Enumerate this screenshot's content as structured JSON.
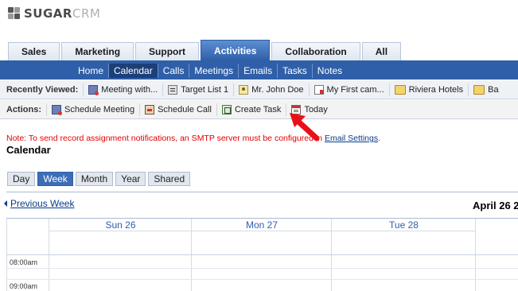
{
  "logo": {
    "text_bold": "SUGAR",
    "text_light": "CRM",
    "icon": "sugarcrm-logo-icon"
  },
  "main_tabs": [
    {
      "label": "Sales",
      "active": false
    },
    {
      "label": "Marketing",
      "active": false
    },
    {
      "label": "Support",
      "active": false
    },
    {
      "label": "Activities",
      "active": true
    },
    {
      "label": "Collaboration",
      "active": false
    },
    {
      "label": "All",
      "active": false
    }
  ],
  "sub_tabs": [
    {
      "label": "Home",
      "active": false
    },
    {
      "label": "Calendar",
      "active": true
    },
    {
      "label": "Calls",
      "active": false
    },
    {
      "label": "Meetings",
      "active": false
    },
    {
      "label": "Emails",
      "active": false
    },
    {
      "label": "Tasks",
      "active": false
    },
    {
      "label": "Notes",
      "active": false
    }
  ],
  "recently_viewed": {
    "label": "Recently Viewed:",
    "items": [
      {
        "label": "Meeting with...",
        "icon": "meeting-icon"
      },
      {
        "label": "Target List 1",
        "icon": "target-list-icon"
      },
      {
        "label": "Mr. John Doe",
        "icon": "contact-icon"
      },
      {
        "label": "My First cam...",
        "icon": "campaign-document-icon"
      },
      {
        "label": "Riviera Hotels",
        "icon": "folder-icon"
      },
      {
        "label": "Ba",
        "icon": "folder-icon"
      }
    ]
  },
  "actions": {
    "label": "Actions:",
    "items": [
      {
        "label": "Schedule Meeting",
        "icon": "schedule-meeting-icon"
      },
      {
        "label": "Schedule Call",
        "icon": "schedule-call-icon"
      },
      {
        "label": "Create Task",
        "icon": "create-task-icon"
      },
      {
        "label": "Today",
        "icon": "today-calendar-icon"
      }
    ]
  },
  "note": {
    "text": "Note: To send record assignment notifications, an SMTP server must be configured in ",
    "link": "Email Settings",
    "suffix": "."
  },
  "page_title": "Calendar",
  "views": [
    {
      "label": "Day",
      "active": false
    },
    {
      "label": "Week",
      "active": true
    },
    {
      "label": "Month",
      "active": false
    },
    {
      "label": "Year",
      "active": false
    },
    {
      "label": "Shared",
      "active": false
    }
  ],
  "calendar": {
    "prev_link": "Previous Week",
    "date_title": "April 26 2",
    "days": [
      "Sun 26",
      "Mon 27",
      "Tue 28"
    ],
    "times": [
      "08:00am",
      "09:00am"
    ]
  },
  "colors": {
    "accent": "#2f5fa8",
    "note_red": "#e00000",
    "annotation_red": "#e8101a"
  }
}
